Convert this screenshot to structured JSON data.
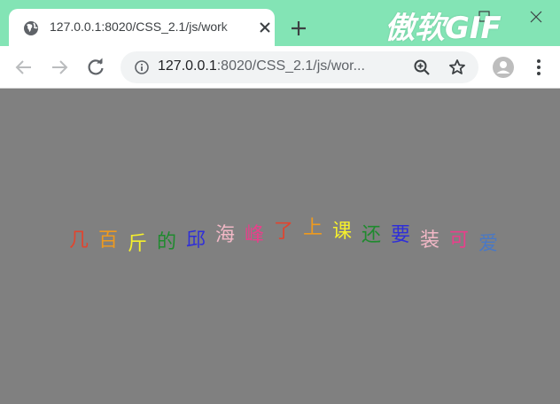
{
  "browser": {
    "tab_title": "127.0.0.1:8020/CSS_2.1/js/work",
    "url_host": "127.0.0.1",
    "url_rest": ":8020/CSS_2.1/js/wor...",
    "watermark": "傲软GIF"
  },
  "icons": {
    "tab_favicon": "globe-icon",
    "tab_close": "close-icon",
    "new_tab": "plus-icon",
    "back": "arrow-left-icon",
    "forward": "arrow-right-icon",
    "reload": "reload-icon",
    "site_info": "info-icon",
    "zoom": "zoom-in-icon",
    "bookmark": "star-icon",
    "profile": "avatar-icon",
    "menu": "kebab-menu-icon"
  },
  "colors": {
    "tabbar_bg": "#83e4b5",
    "page_bg": "#808080"
  },
  "wave_text": [
    {
      "char": "几",
      "color": "#e0452f"
    },
    {
      "char": "百",
      "color": "#ee9a1e"
    },
    {
      "char": "斤",
      "color": "#f5ef2c"
    },
    {
      "char": "的",
      "color": "#1f8a2e"
    },
    {
      "char": "邱",
      "color": "#2f2fd8"
    },
    {
      "char": "海",
      "color": "#f2b8c6"
    },
    {
      "char": "峰",
      "color": "#e83f8b"
    },
    {
      "char": "了",
      "color": "#e0452f"
    },
    {
      "char": "上",
      "color": "#ee9a1e"
    },
    {
      "char": "课",
      "color": "#f5ef2c"
    },
    {
      "char": "还",
      "color": "#1f8a2e"
    },
    {
      "char": "要",
      "color": "#2f2fd8"
    },
    {
      "char": "装",
      "color": "#f2b8c6"
    },
    {
      "char": "可",
      "color": "#e83f8b"
    },
    {
      "char": "爱",
      "color": "#4a78c4"
    }
  ]
}
